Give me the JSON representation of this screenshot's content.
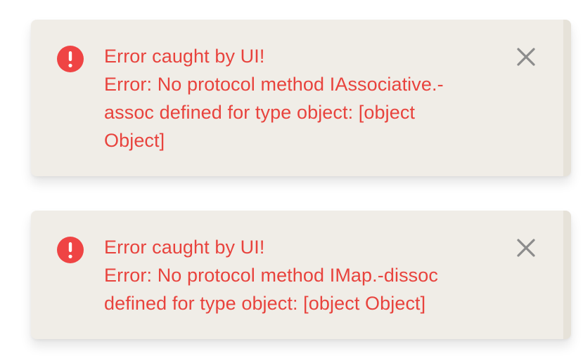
{
  "toasts": [
    {
      "title": "Error caught by UI!",
      "lines": [
        "Error: No protocol method IAssociative.-",
        "assoc defined for type object: [object",
        "Object]"
      ],
      "icon": "alert-circle-icon",
      "close_icon": "close-icon"
    },
    {
      "title": "Error caught by UI!",
      "lines": [
        "Error: No protocol method IMap.-dissoc",
        "defined for type object: [object Object]"
      ],
      "icon": "alert-circle-icon",
      "close_icon": "close-icon"
    }
  ],
  "colors": {
    "error_text": "#e8433d",
    "icon_red": "#ef4444",
    "toast_bg": "#f0ede7",
    "close_gray": "#8c8c8c"
  }
}
